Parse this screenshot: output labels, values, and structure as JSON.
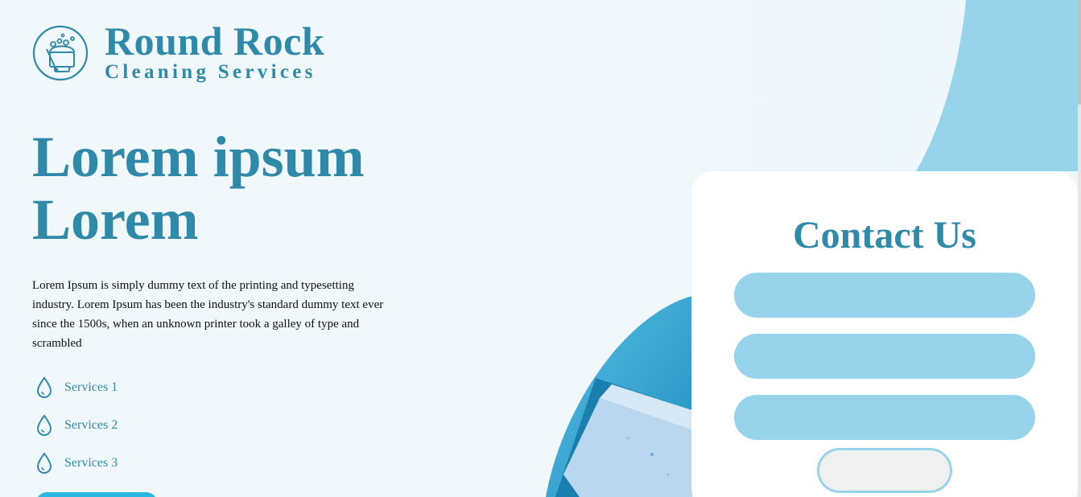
{
  "brand": {
    "title": "Round Rock",
    "subtitle": "Cleaning Services",
    "logo_icon": "cleaning-bucket-icon"
  },
  "hero": {
    "title": "Lorem ipsum Lorem",
    "text": "Lorem Ipsum is simply dummy text of the printing and typesetting industry. Lorem Ipsum has been the industry's standard dummy text ever since the 1500s, when an unknown printer took a galley of type and scrambled"
  },
  "services": [
    {
      "label": "Services 1",
      "icon": "water-drop-icon"
    },
    {
      "label": "Services 2",
      "icon": "water-drop-icon"
    },
    {
      "label": "Services 3",
      "icon": "water-drop-icon"
    }
  ],
  "contact": {
    "title": "Contact Us",
    "fields": [
      {
        "value": "",
        "placeholder": ""
      },
      {
        "value": "",
        "placeholder": ""
      },
      {
        "value": "",
        "placeholder": ""
      }
    ],
    "submit_label": ""
  },
  "colors": {
    "primary": "#2e8aa8",
    "accent_light": "#97d4eb",
    "background": "#f1f8fb",
    "cta": "#29b6df"
  }
}
